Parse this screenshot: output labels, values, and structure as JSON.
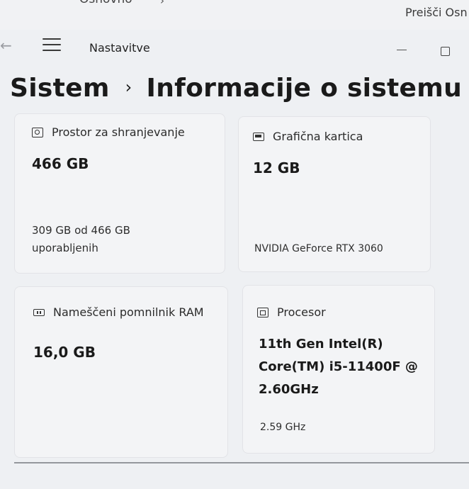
{
  "background_window": {
    "breadcrumb_partial": "Osnovno",
    "jump_link_partial": "Preišči Osn"
  },
  "titlebar": {
    "app_title": "Nastavitve",
    "icons": [
      "back-arrow-icon",
      "hamburger-menu-icon",
      "minimize-icon",
      "maximize-icon"
    ]
  },
  "header": {
    "parent": "Sistem",
    "separator": "›",
    "title": "Informacije o sistemu"
  },
  "cards": [
    {
      "icon": "storage-icon",
      "label": "Prostor za shranjevanje",
      "value": "466 GB",
      "detail_line1": "309 GB od 466 GB",
      "detail_line2": "uporabljenih"
    },
    {
      "icon": "graphics-card-icon",
      "label": "Grafična kartica",
      "value": "12 GB",
      "detail_line1": "NVIDIA GeForce RTX 3060"
    },
    {
      "icon": "ram-icon",
      "label": "Nameščeni pomnilnik RAM",
      "value": "16,0 GB"
    },
    {
      "icon": "processor-icon",
      "label": "Procesor",
      "value_line1": "11th Gen Intel(R)",
      "value_line2": "Core(TM) i5-11400F @",
      "value_line3": "2.60GHz",
      "detail_line1": "2.59 GHz"
    }
  ]
}
